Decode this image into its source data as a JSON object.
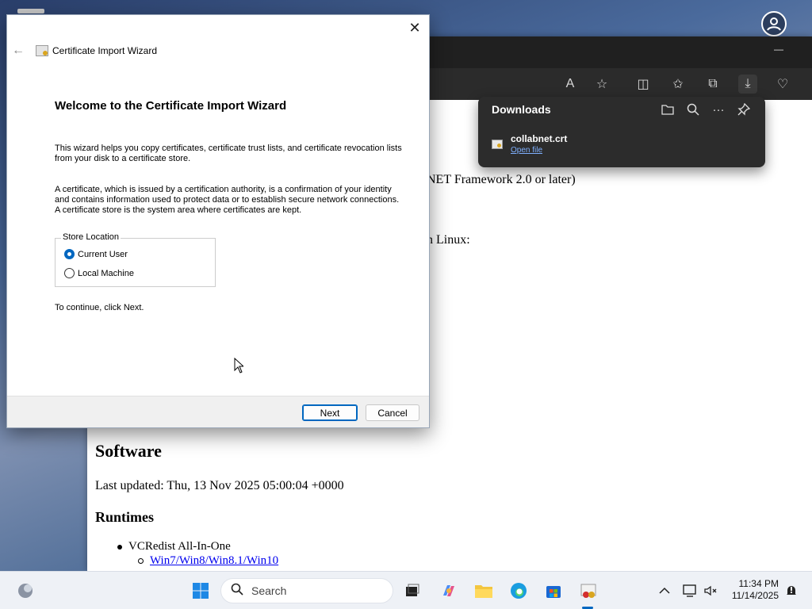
{
  "wizard": {
    "window_title": "Certificate Import Wizard",
    "heading": "Welcome to the Certificate Import Wizard",
    "para1": "This wizard helps you copy certificates, certificate trust lists, and certificate revocation lists from your disk to a certificate store.",
    "para2": "A certificate, which is issued by a certification authority, is a confirmation of your identity and contains information used to protect data or to establish secure network connections. A certificate store is the system area where certificates are kept.",
    "store_location_label": "Store Location",
    "radio_current_user": "Current User",
    "radio_local_machine": "Local Machine",
    "selected": "Current User",
    "continue_text": "To continue, click Next.",
    "next_label": "Next",
    "cancel_label": "Cancel",
    "close_glyph": "✕",
    "back_glyph": "←"
  },
  "downloads": {
    "title": "Downloads",
    "file_name": "collabnet.crt",
    "open_file": "Open file",
    "icons": [
      "folder-icon",
      "search-icon",
      "more-icon",
      "pin-icon"
    ]
  },
  "page": {
    "frag1": "NET Framework 2.0 or later)",
    "frag2": "n Linux:",
    "software_title": "Software",
    "last_updated": "Last updated: Thu, 13 Nov 2025 05:00:04 +0000",
    "runtimes": "Runtimes",
    "item1": "VCRedist All-In-One",
    "subitem1": "Win7/Win8/Win8.1/Win10"
  },
  "taskbar": {
    "search_label": "Search",
    "time": "11:34 PM",
    "date": "11/14/2025"
  },
  "colors": {
    "accent": "#0067c0",
    "taskbar_bg": "#eef1f6",
    "flyout_bg": "#2c2c2c"
  }
}
